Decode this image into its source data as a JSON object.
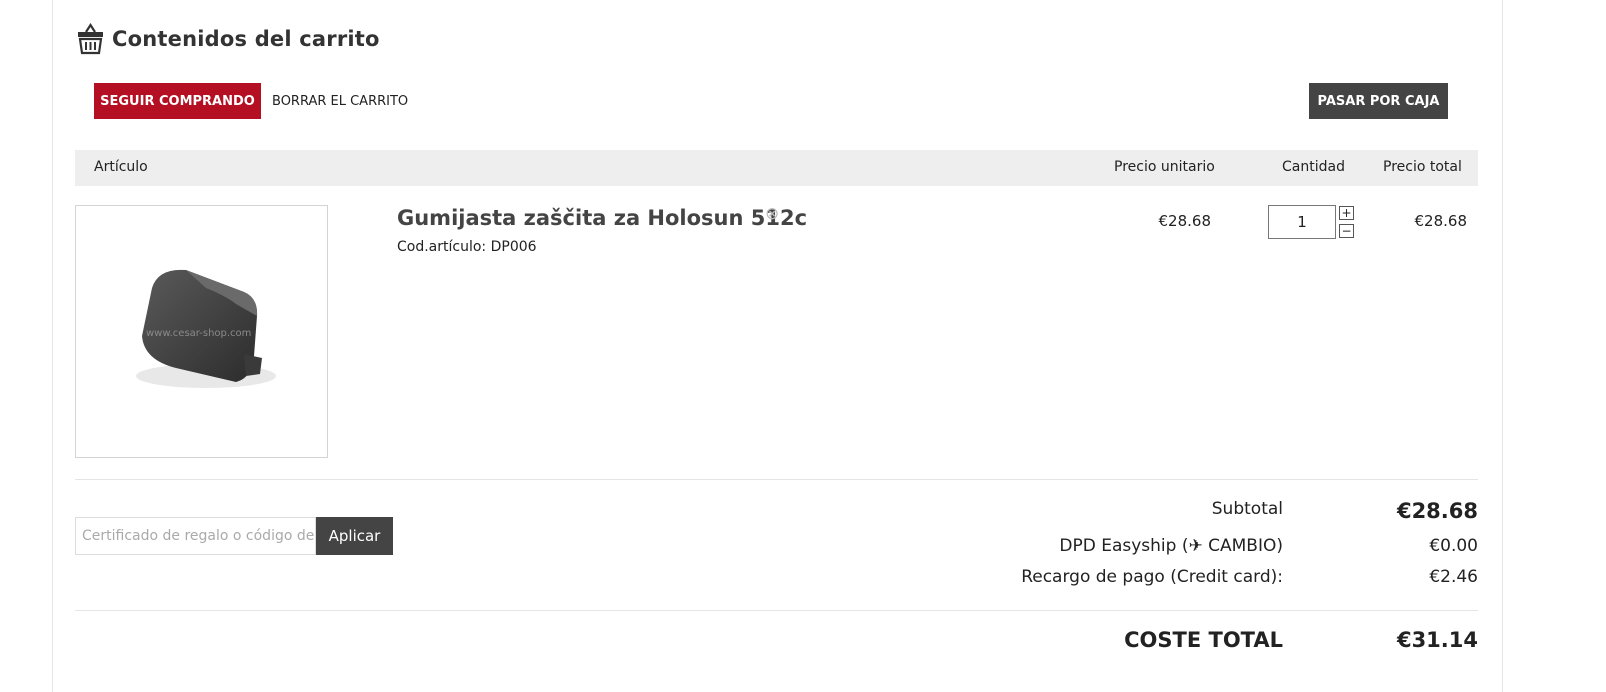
{
  "page": {
    "title": "Contenidos del carrito",
    "title_icon": "basket-icon"
  },
  "actions": {
    "continue_shopping": "SEGUIR COMPRANDO",
    "clear_cart": "BORRAR EL CARRITO",
    "checkout": "PASAR POR CAJA"
  },
  "table": {
    "headers": {
      "item": "Artículo",
      "unit_price": "Precio unitario",
      "quantity": "Cantidad",
      "total": "Precio total"
    }
  },
  "items": [
    {
      "name": "Gumijasta zaščita za Holosun 512c",
      "sku_label": "Cod.artículo: ",
      "sku": "DP006",
      "unit_price": "€28.68",
      "quantity": "1",
      "total": "€28.68",
      "image_watermark": "www.cesar-shop.com"
    }
  ],
  "coupon": {
    "placeholder": "Certificado de regalo o código de descuento",
    "apply_label": "Aplicar"
  },
  "summary": {
    "subtotal_label": "Subtotal",
    "subtotal_value": "€28.68",
    "shipping_prefix": "DPD Easyship (",
    "shipping_change": "✈ CAMBIO",
    "shipping_suffix": ")",
    "shipping_value": "€0.00",
    "surcharge_label": "Recargo de pago (Credit card):",
    "surcharge_value": "€2.46",
    "total_label": "COSTE TOTAL",
    "total_value": "€31.14"
  },
  "colors": {
    "accent": "#b40f22",
    "dark_button": "#444444",
    "header_bg": "#eeeeee"
  }
}
